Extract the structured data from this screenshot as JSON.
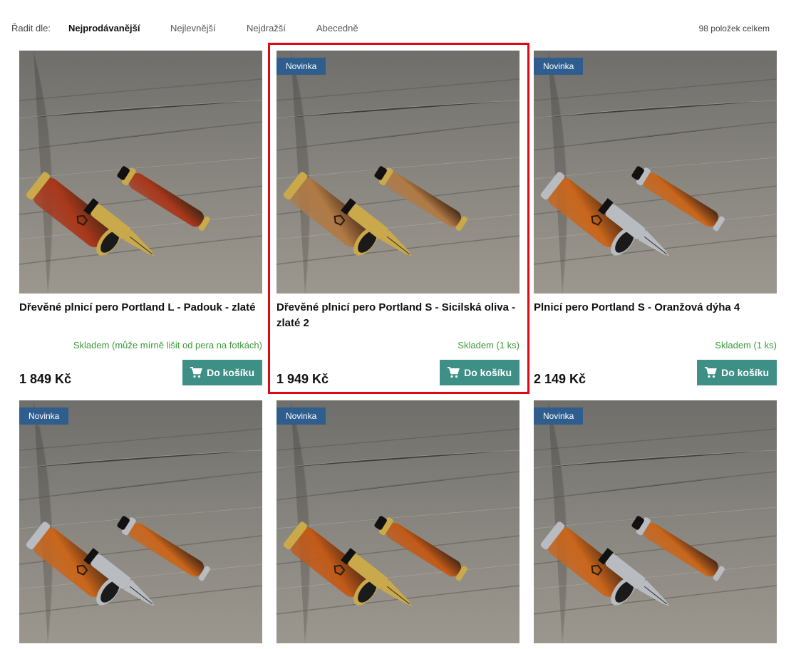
{
  "sort": {
    "label": "Řadit dle:",
    "options": [
      {
        "label": "Nejprodávanější",
        "active": true
      },
      {
        "label": "Nejlevnější",
        "active": false
      },
      {
        "label": "Nejdražší",
        "active": false
      },
      {
        "label": "Abecedně",
        "active": false
      }
    ],
    "total": "98 položek celkem"
  },
  "products": [
    {
      "badge": "",
      "title": "Dřevěné plnicí pero Portland L - Padouk - zlaté",
      "stock": "Skladem (může mírně lišit od pera na fotkách)",
      "price": "1 849 Kč",
      "cart_label": "Do košíku",
      "wood_color": "#a8381c",
      "metal_color": "#c9a94a"
    },
    {
      "badge": "Novinka",
      "title": "Dřevěné plnicí pero Portland S - Sicilská oliva - zlaté 2",
      "stock": "Skladem (1 ks)",
      "price": "1 949 Kč",
      "cart_label": "Do košíku",
      "wood_color": "#b07a45",
      "metal_color": "#c9a94a"
    },
    {
      "badge": "Novinka",
      "title": "Plnicí pero Portland S - Oranžová dýha 4",
      "stock": "Skladem (1 ks)",
      "price": "2 149 Kč",
      "cart_label": "Do košíku",
      "wood_color": "#c9661c",
      "metal_color": "#b8bcc0"
    },
    {
      "badge": "Novinka",
      "wood_color": "#c9661c",
      "metal_color": "#b8bcc0"
    },
    {
      "badge": "Novinka",
      "wood_color": "#c25a18",
      "metal_color": "#c9a94a"
    },
    {
      "badge": "Novinka",
      "wood_color": "#c9661c",
      "metal_color": "#b8bcc0"
    }
  ],
  "colors": {
    "badge": "#2f5e8e",
    "cart_button": "#3e8f86",
    "stock_text": "#3c9a3c",
    "highlight": "#e30613"
  }
}
